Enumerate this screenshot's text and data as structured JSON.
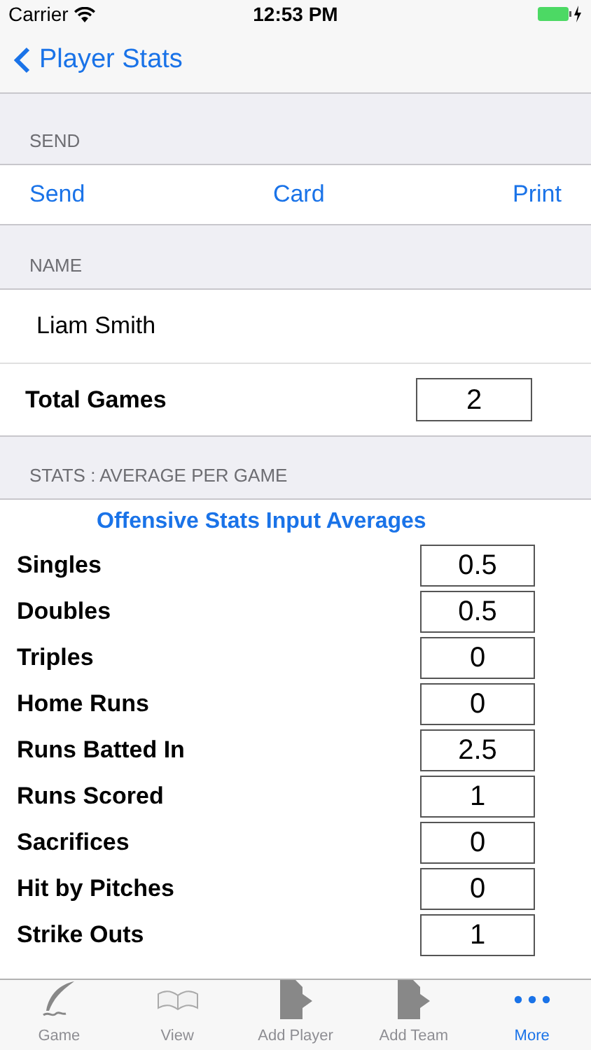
{
  "status_bar": {
    "carrier": "Carrier",
    "time": "12:53 PM"
  },
  "nav": {
    "back_label": "Player Stats"
  },
  "send_section": {
    "header": "SEND",
    "actions": [
      "Send",
      "Card",
      "Print"
    ]
  },
  "name_section": {
    "header": "NAME",
    "name": "Liam Smith",
    "total_games_label": "Total Games",
    "total_games": "2"
  },
  "stats_section": {
    "header": "STATS : AVERAGE PER GAME",
    "title": "Offensive Stats Input Averages",
    "rows": [
      {
        "label": "Singles",
        "value": "0.5"
      },
      {
        "label": "Doubles",
        "value": "0.5"
      },
      {
        "label": "Triples",
        "value": "0"
      },
      {
        "label": "Home Runs",
        "value": "0"
      },
      {
        "label": "Runs Batted In",
        "value": "2.5"
      },
      {
        "label": "Runs Scored",
        "value": "1"
      },
      {
        "label": "Sacrifices",
        "value": "0"
      },
      {
        "label": "Hit by Pitches",
        "value": "0"
      },
      {
        "label": "Strike Outs",
        "value": "1"
      }
    ]
  },
  "tab_bar": [
    {
      "label": "Game",
      "kind": "quill",
      "selected": false
    },
    {
      "label": "View",
      "kind": "book",
      "selected": false
    },
    {
      "label": "Add Player",
      "kind": "document",
      "selected": false
    },
    {
      "label": "Add Team",
      "kind": "document",
      "selected": false
    },
    {
      "label": "More",
      "kind": "more",
      "selected": true
    }
  ]
}
